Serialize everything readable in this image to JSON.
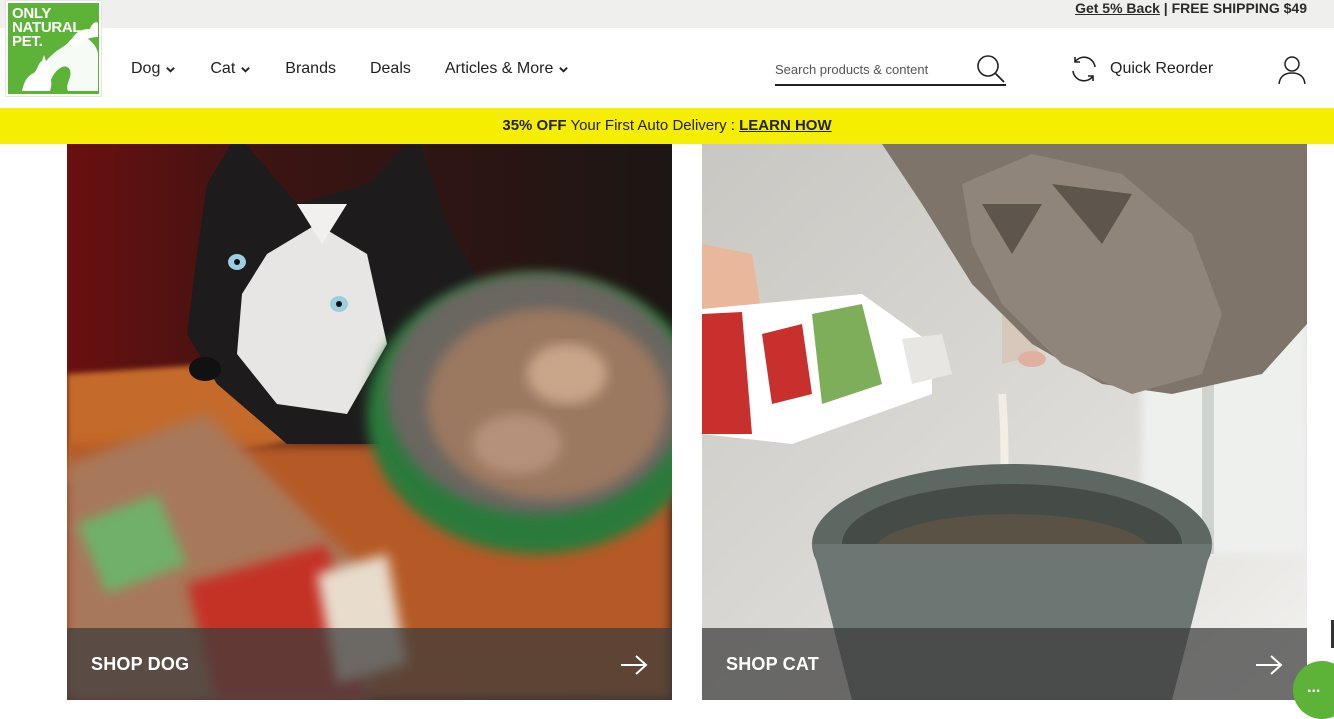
{
  "utility_bar": {
    "cashback_link": "Get 5% Back",
    "separator": " | ",
    "shipping": "FREE SHIPPING $49"
  },
  "logo": {
    "text": "ONLY\nNATURAL\nPET.",
    "brand_color": "#5cb338"
  },
  "nav": {
    "items": [
      {
        "label": "Dog",
        "has_dropdown": true
      },
      {
        "label": "Cat",
        "has_dropdown": true
      },
      {
        "label": "Brands",
        "has_dropdown": false
      },
      {
        "label": "Deals",
        "has_dropdown": false
      },
      {
        "label": "Articles & More",
        "has_dropdown": true
      }
    ]
  },
  "search": {
    "placeholder": "Search products & content",
    "icon": "search-icon"
  },
  "quick_reorder": {
    "label": "Quick Reorder",
    "icon": "refresh-icon"
  },
  "account": {
    "icon": "user-icon"
  },
  "promo": {
    "highlight": "35% OFF",
    "text": " Your First Auto Delivery : ",
    "link": "LEARN HOW",
    "background": "#f6ee01"
  },
  "tiles": [
    {
      "label": "SHOP DOG",
      "icon": "arrow-right-icon"
    },
    {
      "label": "SHOP CAT",
      "icon": "arrow-right-icon"
    }
  ],
  "chat": {
    "label": "..."
  }
}
